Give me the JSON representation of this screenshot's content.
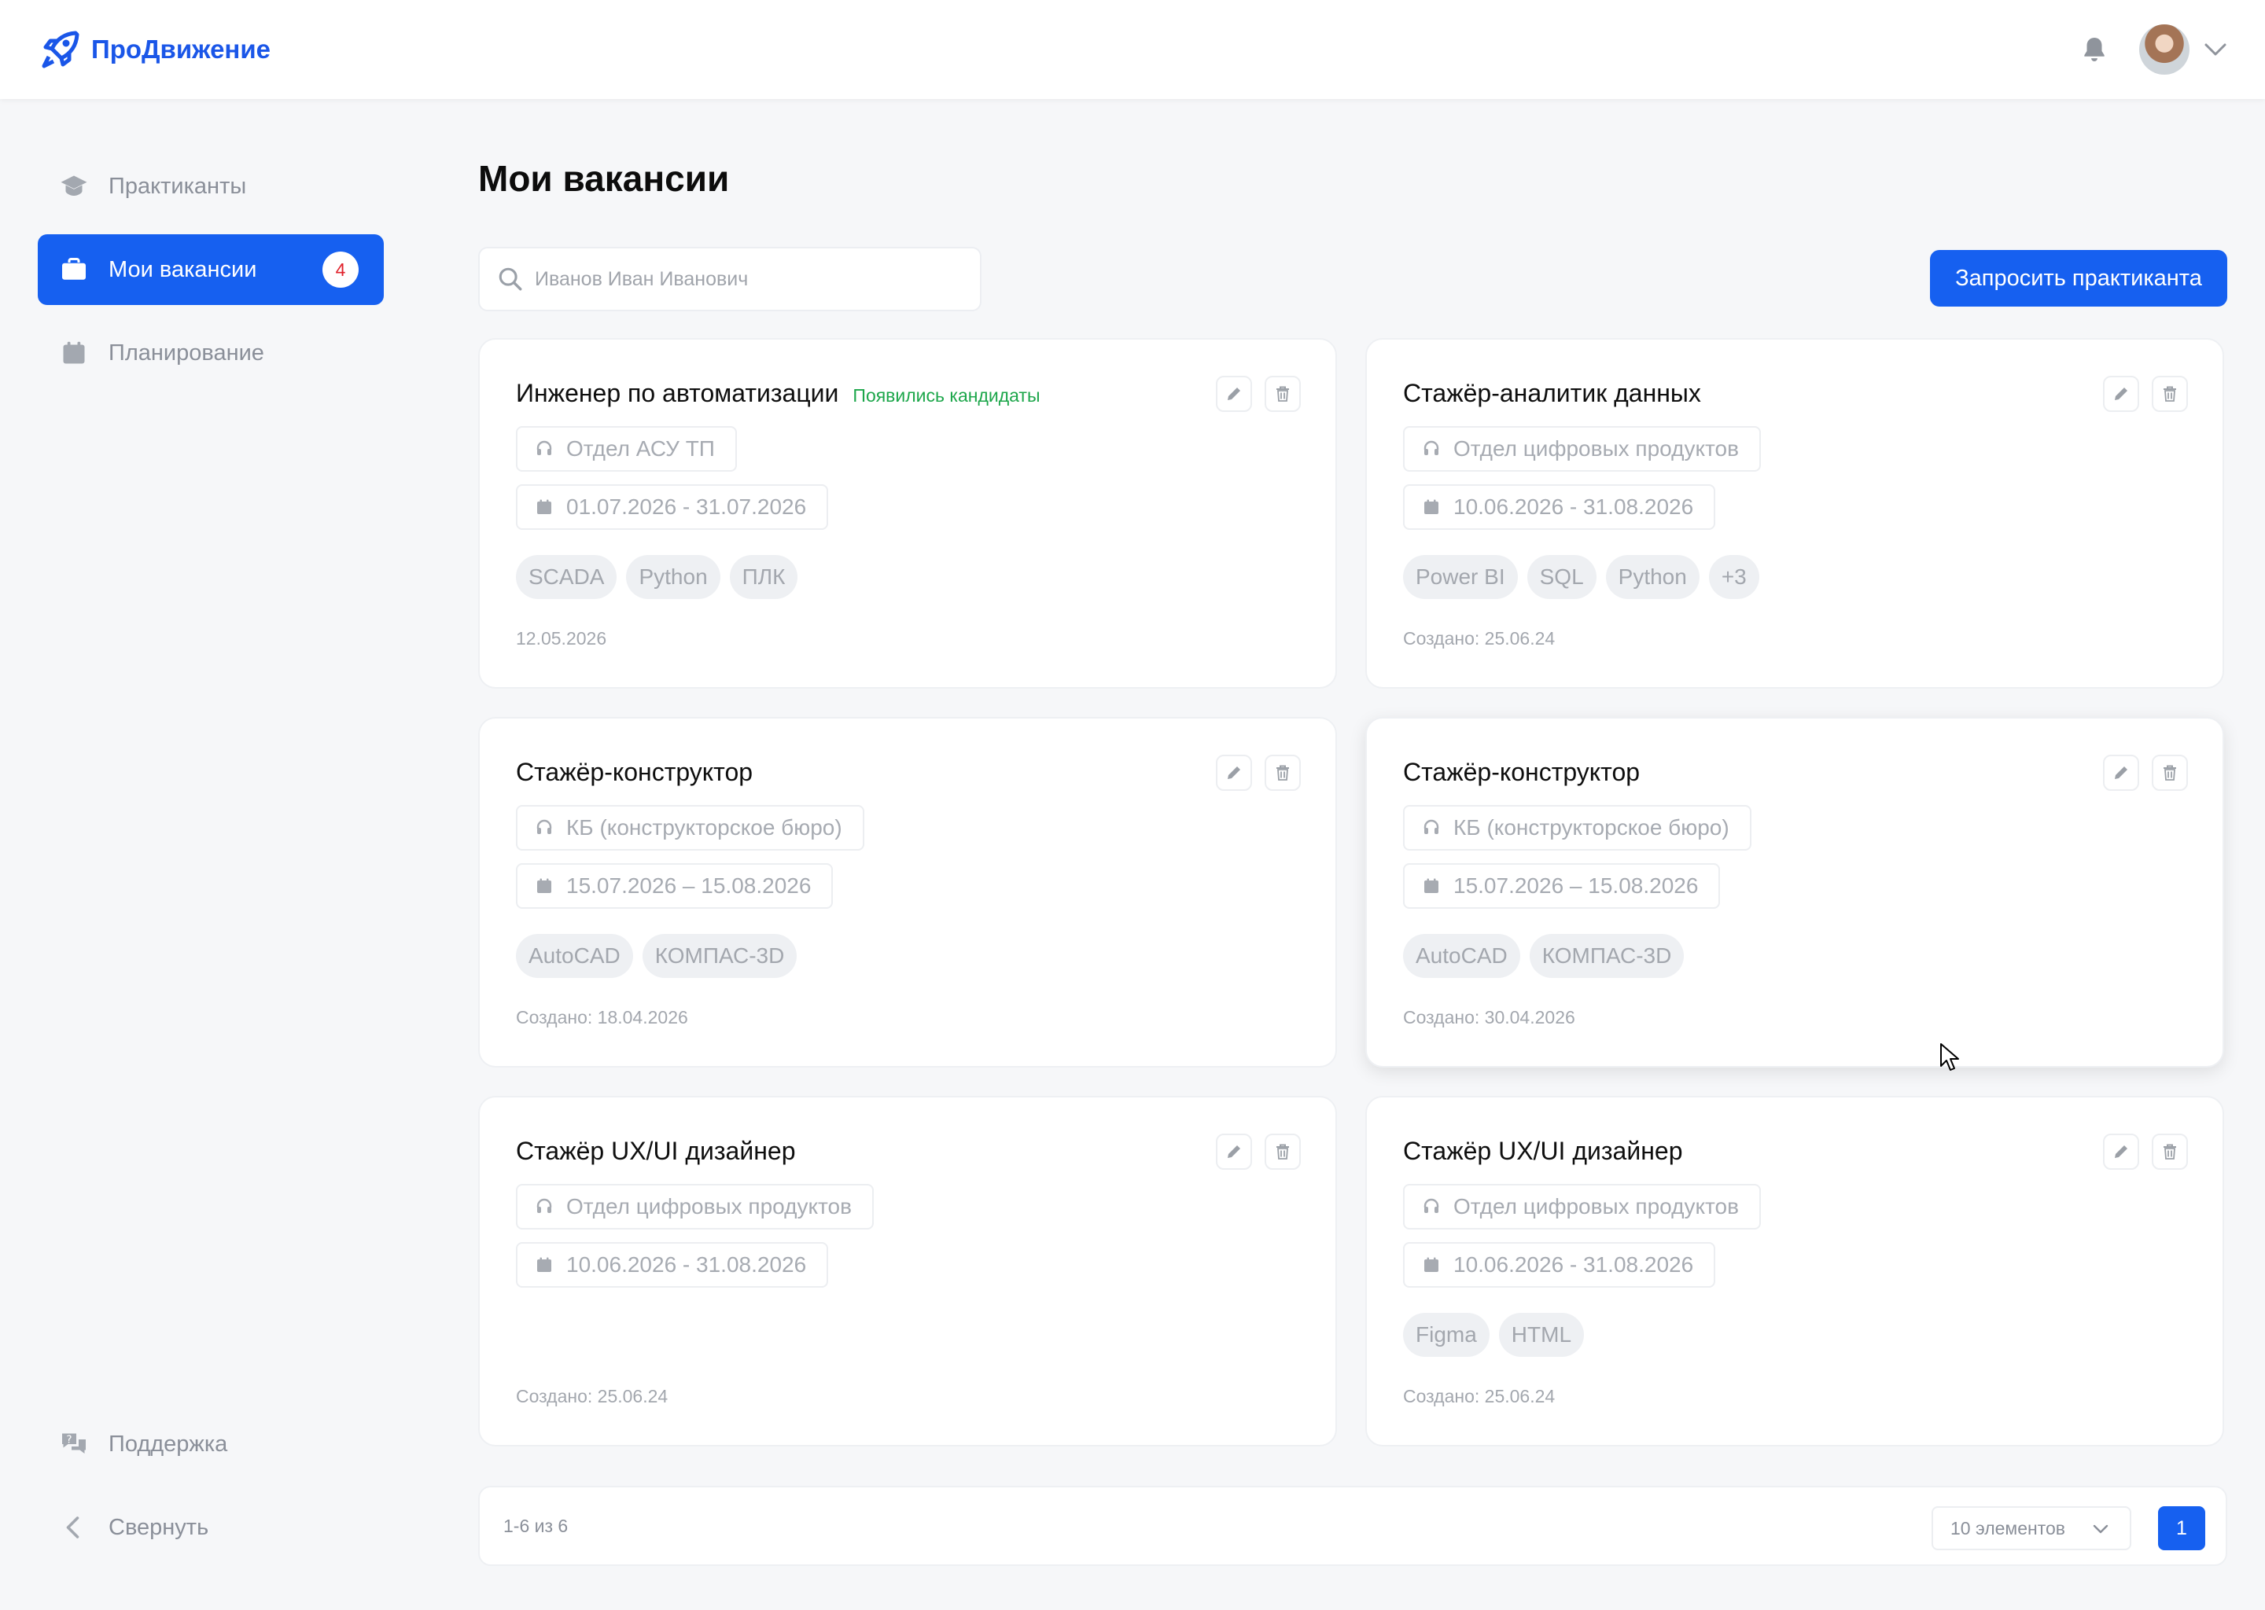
{
  "app": {
    "name": "ПроДвижение",
    "brand_color": "#1660f0"
  },
  "sidebar": {
    "items": [
      {
        "label": "Практиканты",
        "icon": "graduation-cap-icon"
      },
      {
        "label": "Мои вакансии",
        "icon": "briefcase-icon",
        "badge": "4",
        "active": true
      },
      {
        "label": "Планирование",
        "icon": "calendar-icon"
      }
    ],
    "bottom": [
      {
        "label": "Поддержка",
        "icon": "support-chat-icon"
      },
      {
        "label": "Свернуть",
        "icon": "chevron-left-icon"
      }
    ]
  },
  "main": {
    "title": "Мои вакансии",
    "search": {
      "placeholder": "Иванов Иван Иванович",
      "value": ""
    },
    "request_button": "Запросить практиканта",
    "cards": [
      {
        "title": "Инженер по автоматизации",
        "flag": "Появились кандидаты",
        "department": "Отдел АСУ ТП",
        "dates": "01.07.2026 - 31.07.2026",
        "tags": [
          "SCADA",
          "Python",
          "ПЛК"
        ],
        "created": "12.05.2026"
      },
      {
        "title": "Стажёр-аналитик данных",
        "flag": "",
        "department": "Отдел цифровых продуктов",
        "dates": "10.06.2026 - 31.08.2026",
        "tags": [
          "Power BI",
          "SQL",
          "Python",
          "+3"
        ],
        "created": "Создано: 25.06.24"
      },
      {
        "title": "Стажёр-конструктор",
        "flag": "",
        "department": "КБ (конструкторское бюро)",
        "dates": "15.07.2026 – 15.08.2026",
        "tags": [
          "AutoCAD",
          "КОМПАС-3D"
        ],
        "created": "Создано: 18.04.2026"
      },
      {
        "title": "Стажёр-конструктор",
        "flag": "",
        "department": "КБ (конструкторское бюро)",
        "dates": "15.07.2026 – 15.08.2026",
        "tags": [
          "AutoCAD",
          "КОМПАС-3D"
        ],
        "created": "Создано: 30.04.2026"
      },
      {
        "title": "Стажёр UX/UI дизайнер",
        "flag": "",
        "department": "Отдел цифровых продуктов",
        "dates": "10.06.2026 - 31.08.2026",
        "tags": [],
        "created": "Создано: 25.06.24"
      },
      {
        "title": "Стажёр UX/UI дизайнер",
        "flag": "",
        "department": "Отдел цифровых продуктов",
        "dates": "10.06.2026 - 31.08.2026",
        "tags": [
          "Figma",
          "HTML"
        ],
        "created": "Создано: 25.06.24"
      }
    ]
  },
  "pagination": {
    "range": "1-6 из 6",
    "page_size": "10 элементов",
    "current_page": "1"
  }
}
